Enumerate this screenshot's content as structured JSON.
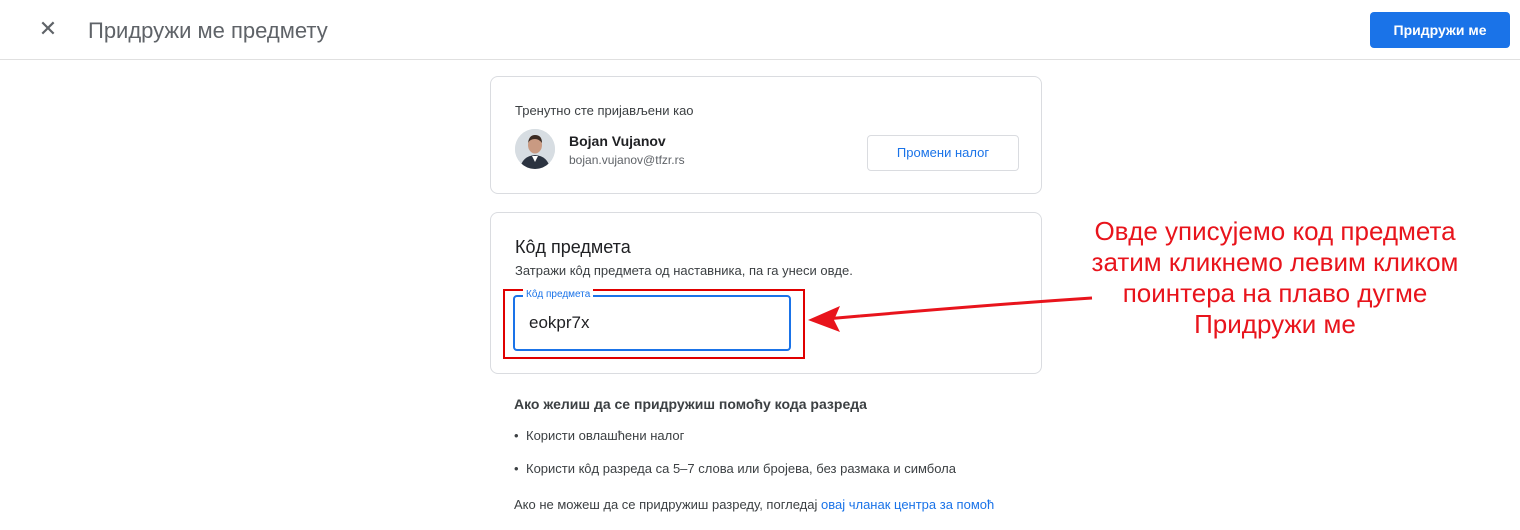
{
  "header": {
    "close_icon": "close-icon",
    "title": "Придружи ме предмету",
    "join_label": "Придружи ме",
    "accent": "#1a73e8"
  },
  "account": {
    "signed_in_label": "Тренутно сте пријављени као",
    "name": "Bojan Vujanov",
    "email": "bojan.vujanov@tfzr.rs",
    "switch_label": "Промени налог"
  },
  "class_code": {
    "title": "Кôд предмета",
    "description": "Затражи кôд предмета од наставника, па га унеси овде.",
    "field_label": "Кôд предмета",
    "field_value": "eokpr7x"
  },
  "info": {
    "title": "Ако желиш да се придружиш помоћу кода разреда",
    "bullets": [
      "Користи овлашћени налог",
      "Користи кôд разреда са 5–7 слова или бројева, без размака и симбола"
    ],
    "help_text": "Ако не можеш да се придружиш разреду, погледај ",
    "help_link": "овај чланак центра за помоћ"
  },
  "annotation": {
    "lines": [
      "Овде уписујемо код предмета",
      "затим кликнемо левим кликом",
      "поинтера на плаво дугме",
      "Придружи ме"
    ],
    "color": "#e8141c"
  }
}
